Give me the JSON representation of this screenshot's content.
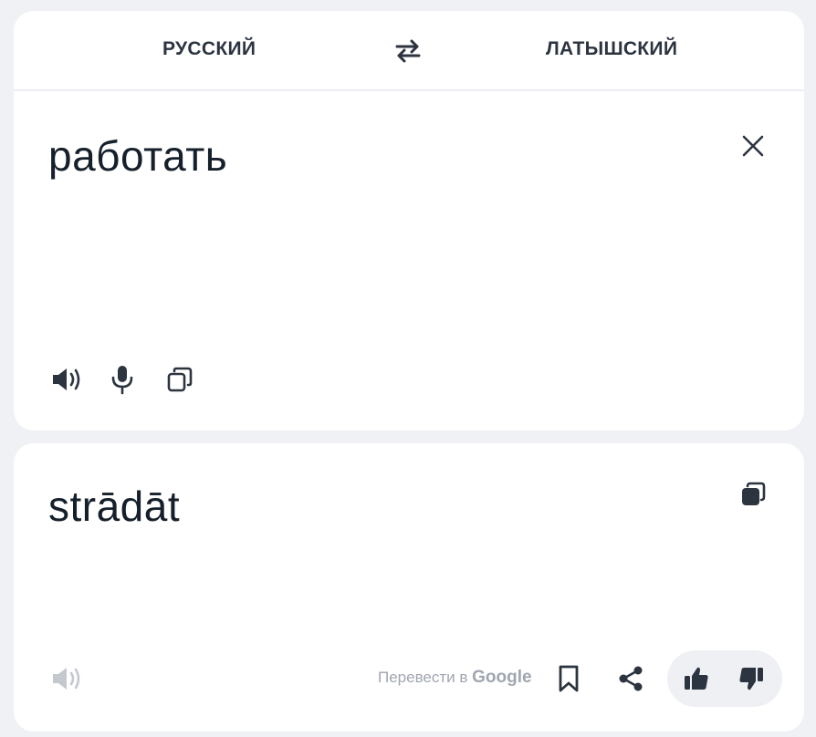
{
  "header": {
    "source_language": "РУССКИЙ",
    "target_language": "ЛАТЫШСКИЙ",
    "swap_icon": "swap-arrows-icon"
  },
  "source": {
    "text": "работать",
    "icons": [
      "close-icon",
      "speaker-icon",
      "microphone-icon",
      "copy-icon"
    ]
  },
  "translation": {
    "text": "strādāt",
    "translate_in_prefix": "Перевести в",
    "translate_in_brand": "Google",
    "icons": [
      "copy-filled-icon",
      "speaker-disabled-icon",
      "bookmark-icon",
      "share-icon",
      "thumbs-up-icon",
      "thumbs-down-icon"
    ]
  },
  "colors": {
    "background": "#f0f1f5",
    "card": "#ffffff",
    "text": "#16202b",
    "icon": "#2c3440",
    "muted": "#a0a6b0",
    "feedback_bg": "#eef0f4"
  }
}
